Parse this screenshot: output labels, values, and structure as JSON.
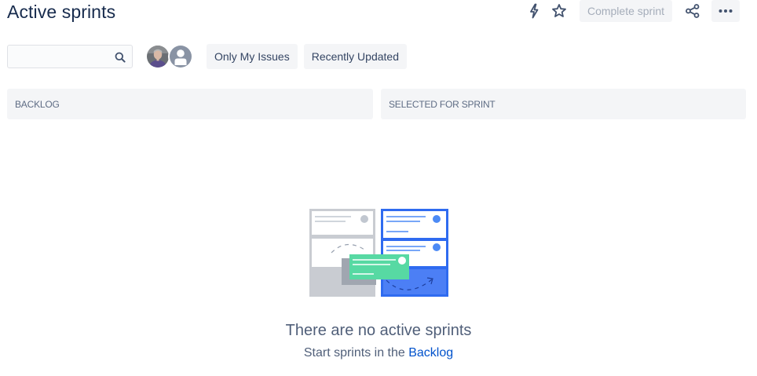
{
  "page": {
    "title": "Active sprints"
  },
  "header": {
    "actions": {
      "automation_icon": "lightning-bolt-icon",
      "star_icon": "star-outline-icon",
      "complete_sprint_label": "Complete sprint",
      "share_icon": "share-icon",
      "more_icon": "ellipsis-icon"
    }
  },
  "filters": {
    "search": {
      "value": "",
      "placeholder": ""
    },
    "avatars": [
      {
        "kind": "photo"
      },
      {
        "kind": "default"
      }
    ],
    "quick_filters": [
      {
        "label": "Only My Issues"
      },
      {
        "label": "Recently Updated"
      }
    ]
  },
  "board": {
    "columns": [
      {
        "label": "BACKLOG"
      },
      {
        "label": "SELECTED FOR SPRINT"
      }
    ]
  },
  "empty_state": {
    "title": "There are no active sprints",
    "subtitle_prefix": "Start sprints in the ",
    "subtitle_link": "Backlog"
  },
  "colors": {
    "text_primary": "#172b4d",
    "text_secondary": "#505f79",
    "link": "#0052cc",
    "button_bg": "#f4f5f7",
    "disabled_text": "#a5adba",
    "illustration_blue": "#2f6bf0",
    "illustration_green": "#57d9a3"
  }
}
